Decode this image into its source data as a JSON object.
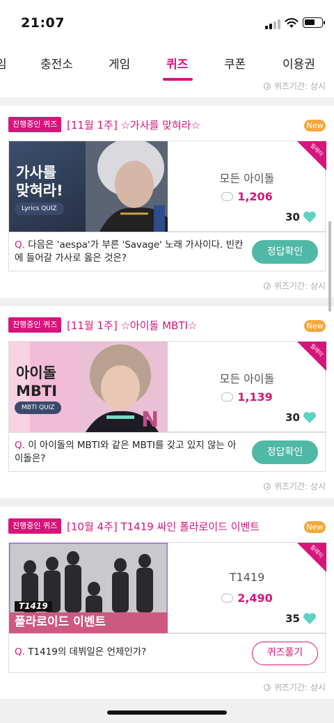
{
  "status": {
    "time": "21:07"
  },
  "tabs": [
    {
      "label": "임"
    },
    {
      "label": "충전소"
    },
    {
      "label": "게임"
    },
    {
      "label": "퀴즈"
    },
    {
      "label": "쿠폰"
    },
    {
      "label": "이용권"
    }
  ],
  "top_period": "퀴즈기간: 상시",
  "cards": [
    {
      "badge": "진행중인 퀴즈",
      "title": "[11월 1주] ☆가사를 맞혀라☆",
      "new_label": "New",
      "ribbon": "릴레이",
      "thumb_title_line1": "가사를",
      "thumb_title_line2": "맞혀라!",
      "thumb_pill": "Lyrics QUIZ",
      "group": "모든 아이돌",
      "count": "1,206",
      "likes": "30",
      "q_prefix": "Q.",
      "question": "다음은 'aespa'가 부른 'Savage' 노래 가사이다. 빈칸에 들어갈 가사로 옳은 것은?",
      "button": "정답확인",
      "period": "퀴즈기간: 상시"
    },
    {
      "badge": "진행중인 퀴즈",
      "title": "[11월 1주] ☆아이돌 MBTI☆",
      "new_label": "New",
      "ribbon": "릴레이",
      "thumb_title_line1": "아이돌",
      "thumb_title_line2": "MBTI",
      "thumb_pill": "MBTI QUIZ",
      "group": "모든 아이돌",
      "count": "1,139",
      "likes": "30",
      "q_prefix": "Q.",
      "question": "이 아이돌의 MBTI와 같은 MBTI를 갖고 있지 않는 아이돌은?",
      "button": "정답확인",
      "period": "퀴즈기간: 상시"
    },
    {
      "badge": "진행중인 퀴즈",
      "title": "[10월 4주] T1419 싸인 폴라로이드 이벤트",
      "new_label": "New",
      "ribbon": "릴레이",
      "thumb_title_line1": "T1419",
      "thumb_title_line2": "폴라로이드 이벤트",
      "group": "T1419",
      "count": "2,490",
      "likes": "35",
      "q_prefix": "Q.",
      "question": "T1419의 데뷔일은 언제인가?",
      "button": "퀴즈풀기",
      "period": "퀴즈기간: 상시"
    }
  ],
  "colors": {
    "accent": "#d6157a",
    "teal": "#4fb8a6",
    "new": "#f3a83a"
  }
}
